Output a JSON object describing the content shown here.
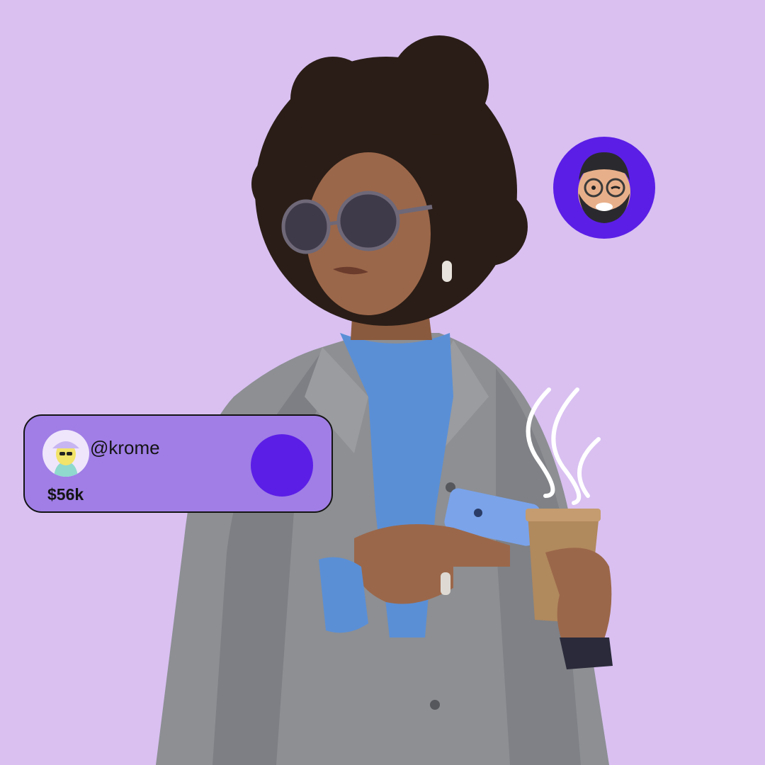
{
  "background_color": "#d9c0f1",
  "accent_color": "#5b1ee6",
  "card": {
    "handle": "@krome",
    "amount": "$56k",
    "avatar_icon": "bucket-hat-user-avatar",
    "fill_color": "#a07ee6"
  },
  "floating_avatar": {
    "icon": "bearded-man-wink-memoji"
  },
  "photo": {
    "subject_icon": "woman-with-phone-and-coffee",
    "steam_icon": "steam-lines-icon"
  }
}
